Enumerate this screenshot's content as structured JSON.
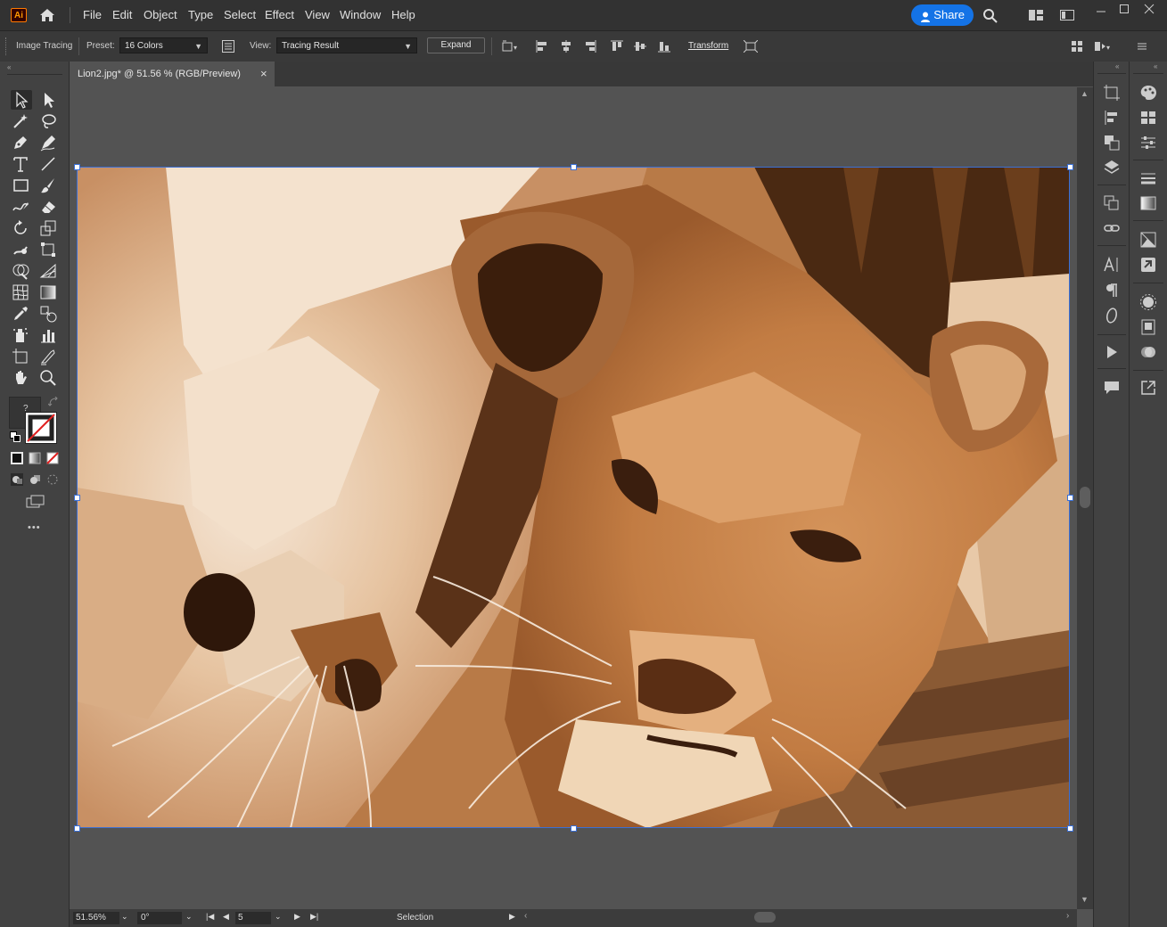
{
  "menu": {
    "app_icon": "Ai",
    "items": [
      "File",
      "Edit",
      "Object",
      "Type",
      "Select",
      "Effect",
      "View",
      "Window",
      "Help"
    ],
    "share_label": "Share"
  },
  "control_bar": {
    "mode_label": "Image Tracing",
    "preset_label": "Preset:",
    "preset_value": "16 Colors",
    "view_label": "View:",
    "view_value": "Tracing Result",
    "expand_label": "Expand",
    "transform_label": "Transform"
  },
  "document": {
    "tab_title": "Lion2.jpg* @ 51.56 % (RGB/Preview)",
    "close_glyph": "×"
  },
  "status": {
    "zoom": "51.56%",
    "rotation": "0°",
    "artboard_number": "5",
    "tool_name": "Selection"
  },
  "toolbar": {
    "more_glyph": "•••",
    "question_glyph": "?"
  },
  "colors": {
    "accent": "#1473e6",
    "selection": "#3a6fd6",
    "ui_dark": "#323232",
    "ui_mid": "#424242",
    "canvas": "#535353"
  },
  "icons": [
    "selection-tool-icon",
    "direct-selection-tool-icon",
    "magic-wand-icon",
    "lasso-icon",
    "pen-icon",
    "curvature-icon",
    "type-icon",
    "line-icon",
    "rectangle-icon",
    "paintbrush-icon",
    "shaper-icon",
    "eraser-icon",
    "rotate-icon",
    "scale-icon",
    "warp-icon",
    "free-transform-icon",
    "shape-builder-icon",
    "perspective-icon",
    "mesh-icon",
    "gradient-icon",
    "eyedropper-icon",
    "blend-icon",
    "symbol-sprayer-icon",
    "column-graph-icon",
    "artboard-icon",
    "slice-icon",
    "hand-icon",
    "zoom-icon"
  ]
}
